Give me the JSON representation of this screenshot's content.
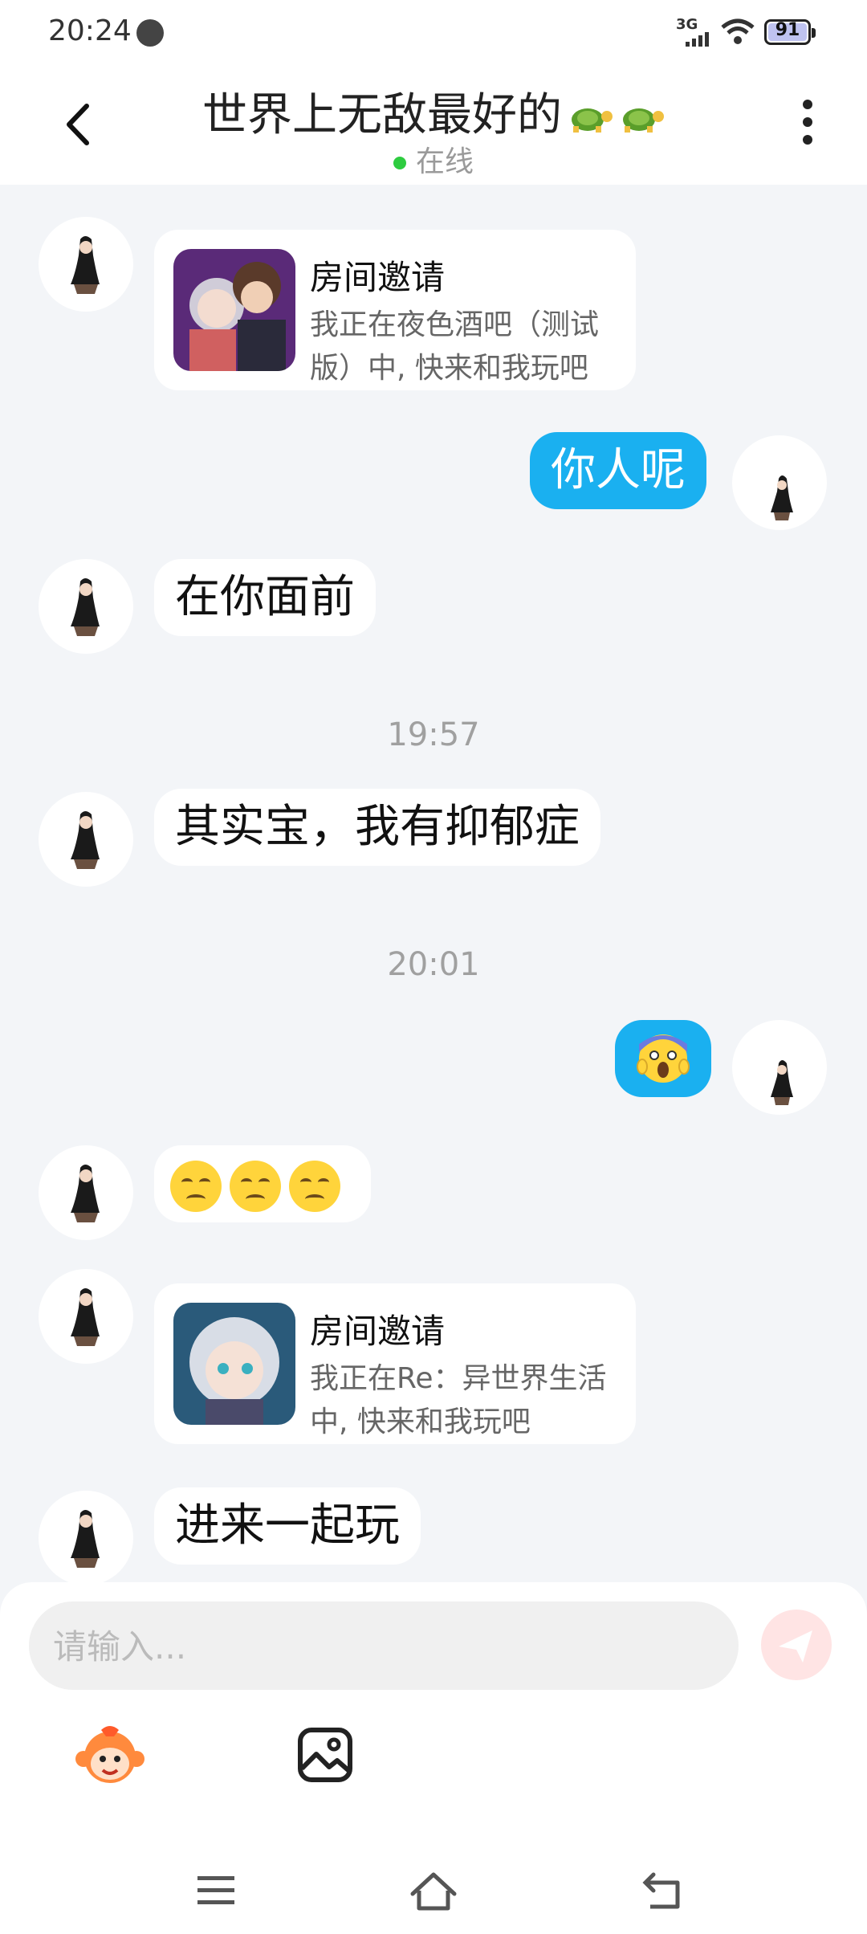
{
  "status_bar": {
    "time": "20:24",
    "network": "3G",
    "battery": "91"
  },
  "header": {
    "title": "世界上无敌最好的",
    "status": "在线"
  },
  "messages": {
    "invite1": {
      "title": "房间邀请",
      "desc": "我正在夜色酒吧（测试版）中, 快来和我玩吧"
    },
    "m_me1": "你人呢",
    "m_them1": "在你面前",
    "time1": "19:57",
    "m_them2": "其实宝，我有抑郁症",
    "time2": "20:01",
    "invite2": {
      "title": "房间邀请",
      "desc": "我正在Re：异世界生活中, 快来和我玩吧"
    },
    "m_them3": "进来一起玩"
  },
  "composer": {
    "placeholder": "请输入..."
  },
  "colors": {
    "sent_bubble": "#1ab0f0",
    "online_dot": "#2ecc40",
    "send_button": "#ffe4e4"
  }
}
